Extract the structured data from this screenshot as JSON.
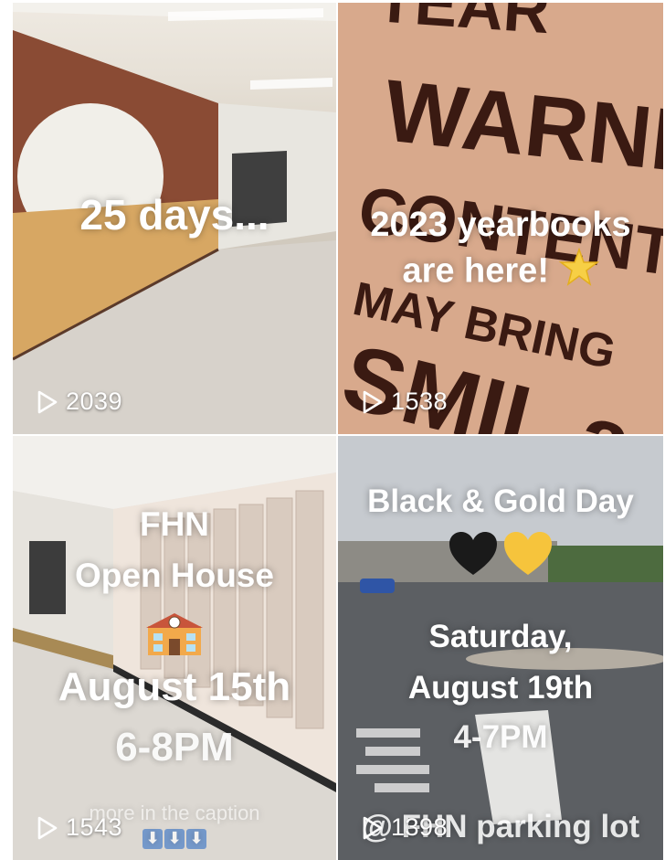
{
  "videos": [
    {
      "overlay": "25 days...",
      "views": "2039"
    },
    {
      "overlay_line1": "2023 yearbooks",
      "overlay_line2": "are here!",
      "emoji": "star-emoji",
      "views": "1538",
      "sign_text": "WARNING CONTENTS MAY BRING SMILES"
    },
    {
      "line1": "FHN",
      "line2": "Open House",
      "emoji": "school-emoji",
      "line3": "August 15th",
      "line4": "6-8PM",
      "caption_hint": "more in the caption",
      "views": "1543"
    },
    {
      "line1": "Black & Gold Day",
      "emoji": "black-and-gold-hearts-emoji",
      "line2": "Saturday,",
      "line3": "August 19th",
      "line4": "4-7PM",
      "line5": "@ FHN parking lot",
      "views": "1398"
    }
  ],
  "colors": {
    "overlay_text": "#ffffff",
    "sign_paint": "#3a1a12",
    "sign_board": "#d9ab8e"
  },
  "icons": {
    "views": "play-outline-icon"
  }
}
